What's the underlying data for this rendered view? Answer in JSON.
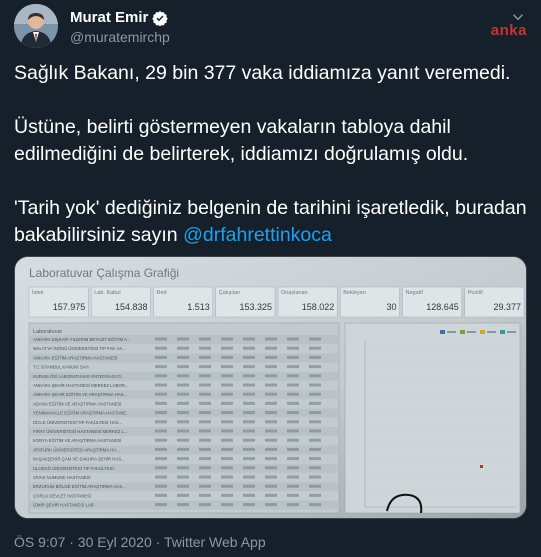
{
  "tweet": {
    "display_name": "Murat Emir",
    "handle": "@muratemirchp",
    "watermark": "anka",
    "paragraph1": "Sağlık Bakanı, 29 bin 377 vaka iddiamıza yanıt veremedi.",
    "paragraph2": "Üstüne, belirti göstermeyen vakaların tabloya dahil edilmediğini de belirterek, iddiamızı doğrulamış oldu.",
    "paragraph3_text": "'Tarih yok' dediğiniz belgenin de tarihini işaretledik, buradan bakabilirsiniz sayın ",
    "mention": "@drfahrettinkoca",
    "timestamp": "ÖS 9:07 · 30 Eyl 2020 · Twitter Web App"
  },
  "photo": {
    "title": "Laboratuvar Çalışma Grafiği",
    "stats": [
      {
        "label": "İstek",
        "value": "157.975"
      },
      {
        "label": "Lab. Kabul",
        "value": "154.838"
      },
      {
        "label": "Red",
        "value": "1.513"
      },
      {
        "label": "Çalışılan",
        "value": "153.325"
      },
      {
        "label": "Onaylanan",
        "value": "158.022"
      },
      {
        "label": "Bekleyen",
        "value": "30"
      },
      {
        "label": "Negatif",
        "value": "128.645"
      },
      {
        "label": "Pozitif",
        "value": "29.377"
      }
    ],
    "list_header": "Laboratuvar",
    "rows": [
      "ANKARA DIŞKAPI YILDIRIM BEYAZIT EĞİTİM A...",
      "MALATYA İNÖNÜ ÜNİVERSİTESİ TIP FAK HA...",
      "ANKARA EĞİTİM ARAŞTIRMA HASTANESİ",
      "T.C İSTANBUL KANUNİ SAH",
      "KURUM ÖSİ LABORATUVAR ENTEGRASYO...",
      "ANKARA ŞEHİR HASTANESİ MERKEZ LABOR...",
      "ANKARA ŞEHİR EĞİTİM VE ARAŞTIRMA HAS...",
      "ADANA EĞİTİM VE ARAŞTIRMA HASTANESİ",
      "YENİMAHALLE EĞİTİM ARAŞTIRMA HASTANE...",
      "DİCLE ÜNİVERSİTESİ TIP FAKÜLTESİ HAS...",
      "FIRAT ÜNİVERSİTESİ HASTANESİ MERKEZ L...",
      "KONYA EĞİTİM VE ARAŞTIRMA HASTANESİ",
      "ATATÜRK ÜNİVERSİTESİ ARAŞTIRMA HA...",
      "BAŞAKŞEHİR ÇAM VE SAKURA ŞEHİR HAS...",
      "ULUDAĞ ÜNİVERSİTESİ TIP FAKÜLTESİ",
      "SİVAS NUMUNE HASTANESİ",
      "ERZURUM BÖLGE EĞİTİM ARAŞTIRMA HAS...",
      "ÇORLU DEVLET HASTANESİ",
      "İZMİR ŞEHİR HASTANESİ LAB"
    ]
  }
}
